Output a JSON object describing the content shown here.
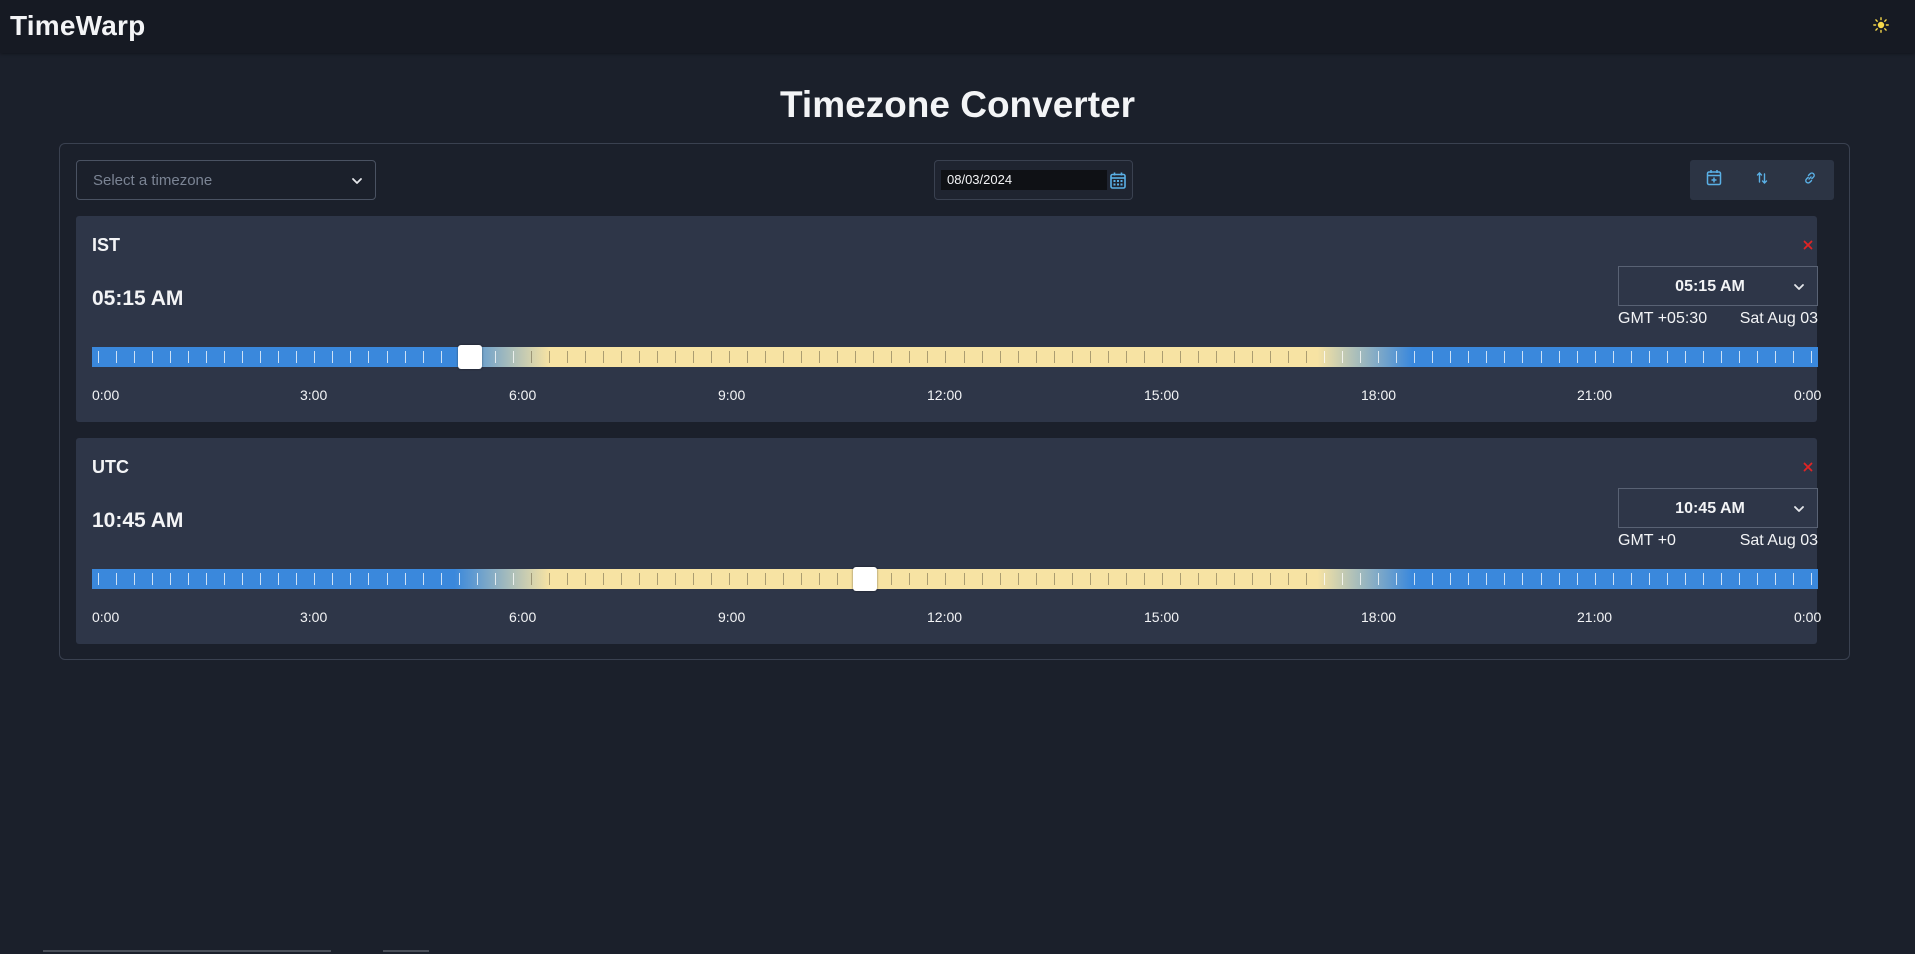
{
  "app": {
    "title": "TimeWarp",
    "theme_icon": "sun-icon"
  },
  "page": {
    "title": "Timezone Converter"
  },
  "controls": {
    "timezone_placeholder": "Select a timezone",
    "date_value": "08/03/2024",
    "actions": [
      {
        "name": "calendar-add-icon"
      },
      {
        "name": "swap-sort-icon"
      },
      {
        "name": "link-icon"
      }
    ]
  },
  "hour_labels": [
    "0:00",
    "3:00",
    "6:00",
    "9:00",
    "12:00",
    "15:00",
    "18:00",
    "21:00",
    "0:00"
  ],
  "zones": [
    {
      "abbr": "IST",
      "time": "05:15 AM",
      "select_time": "05:15 AM",
      "offset": "GMT +05:30",
      "day": "Sat Aug 03",
      "hour_fraction": 0.21875
    },
    {
      "abbr": "UTC",
      "time": "10:45 AM",
      "select_time": "10:45 AM",
      "offset": "GMT +0",
      "day": "Sat Aug 03",
      "hour_fraction": 0.4479
    }
  ],
  "colors": {
    "night": "#3a88dc",
    "day": "#f7e3a3",
    "accent": "#5ab0e6",
    "remove": "#e02424"
  }
}
